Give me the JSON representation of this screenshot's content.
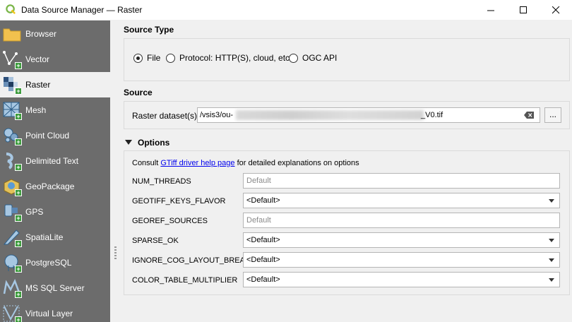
{
  "window": {
    "title": "Data Source Manager — Raster",
    "controls": {
      "minimize": "—",
      "maximize": "☐",
      "close": "✕"
    }
  },
  "sidebar": {
    "items": [
      {
        "label": "Browser",
        "icon": "folder-icon"
      },
      {
        "label": "Vector",
        "icon": "vector-icon"
      },
      {
        "label": "Raster",
        "icon": "raster-icon",
        "selected": true
      },
      {
        "label": "Mesh",
        "icon": "mesh-icon"
      },
      {
        "label": "Point Cloud",
        "icon": "point-cloud-icon"
      },
      {
        "label": "Delimited Text",
        "icon": "delimited-text-icon"
      },
      {
        "label": "GeoPackage",
        "icon": "geopackage-icon"
      },
      {
        "label": "GPS",
        "icon": "gps-icon"
      },
      {
        "label": "SpatiaLite",
        "icon": "spatialite-icon"
      },
      {
        "label": "PostgreSQL",
        "icon": "postgresql-icon"
      },
      {
        "label": "MS SQL Server",
        "icon": "mssql-icon"
      },
      {
        "label": "Virtual Layer",
        "icon": "virtual-layer-icon"
      }
    ]
  },
  "source_type": {
    "heading": "Source Type",
    "options": [
      {
        "label": "File",
        "checked": true
      },
      {
        "label": "Protocol: HTTP(S), cloud, etc.",
        "checked": false
      },
      {
        "label": "OGC API",
        "checked": false
      }
    ]
  },
  "source": {
    "heading": "Source",
    "dataset_label": "Raster dataset(s)",
    "dataset_value_prefix": "/vsis3/ou-",
    "dataset_value_suffix": "_V0.tif",
    "browse_label": "..."
  },
  "options": {
    "heading": "Options",
    "consult_prefix": "Consult ",
    "consult_link": "GTiff driver help page",
    "consult_suffix": " for detailed explanations on options",
    "rows": [
      {
        "name": "NUM_THREADS",
        "kind": "text",
        "placeholder": "Default"
      },
      {
        "name": "GEOTIFF_KEYS_FLAVOR",
        "kind": "combo",
        "value": "<Default>"
      },
      {
        "name": "GEOREF_SOURCES",
        "kind": "text",
        "placeholder": "Default"
      },
      {
        "name": "SPARSE_OK",
        "kind": "combo",
        "value": "<Default>"
      },
      {
        "name": "IGNORE_COG_LAYOUT_BREAK",
        "kind": "combo",
        "value": "<Default>"
      },
      {
        "name": "COLOR_TABLE_MULTIPLIER",
        "kind": "combo",
        "value": "<Default>"
      }
    ]
  },
  "colors": {
    "sidebar_bg": "#6c6c6c",
    "accent_green": "#3c9b3c",
    "link": "#0000ee"
  }
}
